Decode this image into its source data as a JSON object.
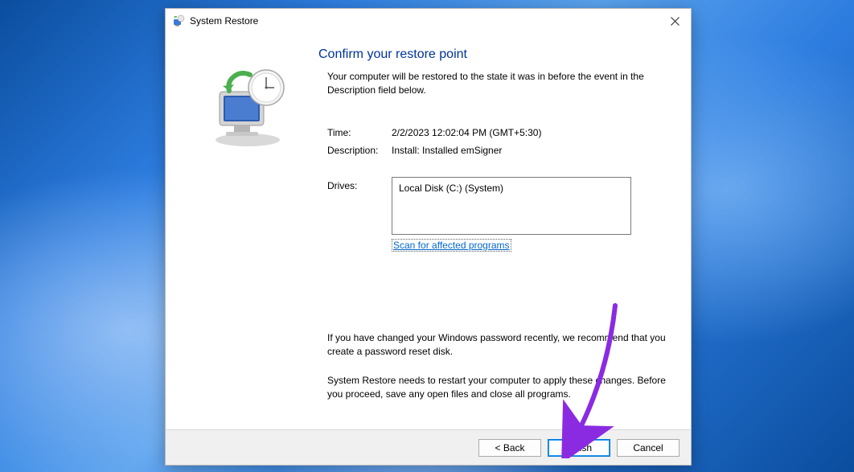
{
  "window": {
    "title": "System Restore"
  },
  "main": {
    "heading": "Confirm your restore point",
    "subtext": "Your computer will be restored to the state it was in before the event in the Description field below.",
    "time_label": "Time:",
    "time_value": "2/2/2023 12:02:04 PM (GMT+5:30)",
    "description_label": "Description:",
    "description_value": "Install: Installed emSigner",
    "drives_label": "Drives:",
    "drives_value": "Local Disk (C:) (System)",
    "scan_link": "Scan for affected programs",
    "warning1": "If you have changed your Windows password recently, we recommend that you create a password reset disk.",
    "warning2": "System Restore needs to restart your computer to apply these changes. Before you proceed, save any open files and close all programs."
  },
  "buttons": {
    "back": "< Back",
    "finish": "Finish",
    "cancel": "Cancel"
  },
  "annotation": {
    "arrow_color": "#8a2be2"
  }
}
